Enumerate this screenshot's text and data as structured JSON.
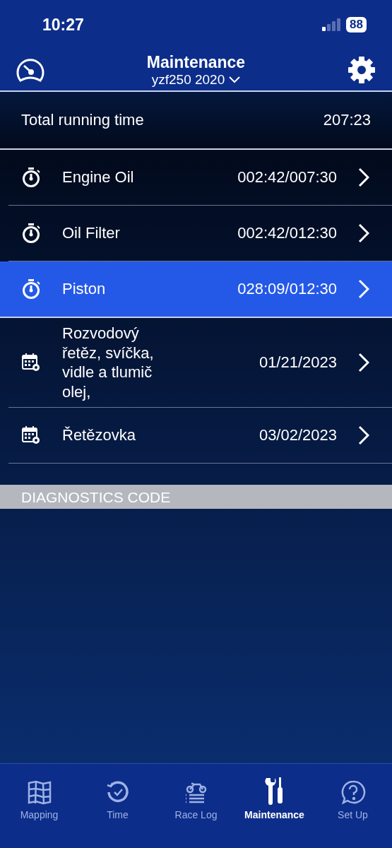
{
  "status_bar": {
    "time": "10:27",
    "battery": "88"
  },
  "header": {
    "title": "Maintenance",
    "subtitle": "yzf250 2020"
  },
  "total": {
    "label": "Total running time",
    "value": "207:23"
  },
  "items": [
    {
      "kind": "timer",
      "name": "Engine Oil",
      "value": "002:42/007:30",
      "selected": false
    },
    {
      "kind": "timer",
      "name": "Oil Filter",
      "value": "002:42/012:30",
      "selected": false
    },
    {
      "kind": "timer",
      "name": "Piston",
      "value": "028:09/012:30",
      "selected": true
    },
    {
      "kind": "calendar",
      "name": "Rozvodový řetěz, svíčka, vidle a tlumič olej,",
      "value": "01/21/2023",
      "selected": false
    },
    {
      "kind": "calendar",
      "name": "Řetězovka",
      "value": "03/02/2023",
      "selected": false
    }
  ],
  "section": {
    "title": "DIAGNOSTICS CODE"
  },
  "tabs": [
    {
      "kind": "map",
      "label": "Mapping",
      "selected": false
    },
    {
      "kind": "clock",
      "label": "Time",
      "selected": false
    },
    {
      "kind": "bike",
      "label": "Race Log",
      "selected": false
    },
    {
      "kind": "tools",
      "label": "Maintenance",
      "selected": true
    },
    {
      "kind": "help",
      "label": "Set Up",
      "selected": false
    }
  ]
}
